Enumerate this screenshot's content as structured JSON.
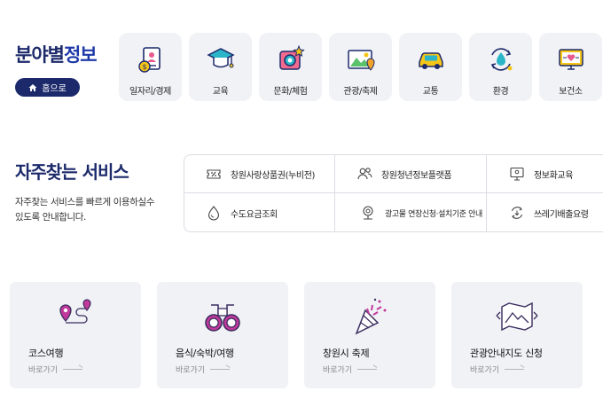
{
  "field_info": {
    "title_part1": "분야별",
    "title_part2": "정보",
    "home_label": "홈으로",
    "categories": [
      {
        "label": "일자리/경제",
        "icon": "jobs-document-icon"
      },
      {
        "label": "교육",
        "icon": "graduation-cap-icon"
      },
      {
        "label": "문화/체험",
        "icon": "culture-camera-icon"
      },
      {
        "label": "관광/축제",
        "icon": "tourism-picture-icon"
      },
      {
        "label": "교통",
        "icon": "car-icon"
      },
      {
        "label": "환경",
        "icon": "recycle-water-icon"
      },
      {
        "label": "보건소",
        "icon": "health-monitor-icon"
      }
    ]
  },
  "frequent": {
    "title": "자주찾는 서비스",
    "desc_line1": "자주찾는 서비스를 빠르게 이용하실수",
    "desc_line2": "있도록 안내합니다.",
    "services": [
      {
        "label": "창원사랑상품권(누비전)",
        "icon": "coupon-percent-icon"
      },
      {
        "label": "창원청년정보플랫폼",
        "icon": "people-icon"
      },
      {
        "label": "정보화교육",
        "icon": "computer-icon"
      },
      {
        "label": "수도요금조회",
        "icon": "water-drop-icon"
      },
      {
        "label": "광고물 연장신청·설치기준 안내",
        "icon": "billboard-icon"
      },
      {
        "label": "쓰레기배출요령",
        "icon": "recycle-icon"
      }
    ]
  },
  "cards": [
    {
      "title": "코스여행",
      "go": "바로가기",
      "icon": "course-route-icon"
    },
    {
      "title": "음식/숙박/여행",
      "go": "바로가기",
      "icon": "binoculars-icon"
    },
    {
      "title": "창원시 축제",
      "go": "바로가기",
      "icon": "party-popper-icon"
    },
    {
      "title": "관광안내지도 신청",
      "go": "바로가기",
      "icon": "map-icon"
    }
  ],
  "colors": {
    "navy": "#1c2a6b",
    "accent_pink": "#c0399b",
    "yellow": "#f5c518"
  }
}
